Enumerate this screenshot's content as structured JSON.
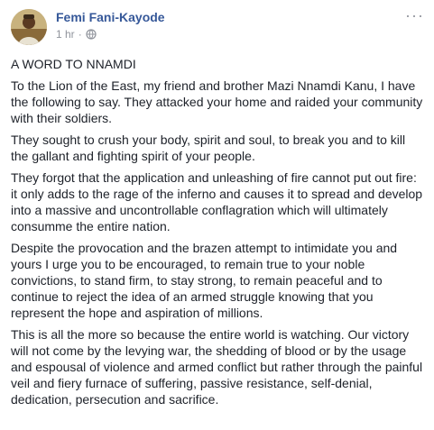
{
  "post": {
    "author": "Femi Fani-Kayode",
    "time": "1 hr",
    "dot": "·",
    "more_label": "···",
    "icons": {
      "globe": "globe-icon",
      "more": "more-options-icon"
    },
    "colors": {
      "author_link": "#365899",
      "meta_text": "#90949c",
      "body_text": "#1d2129"
    },
    "paragraphs": [
      "A WORD TO NNAMDI",
      "To the Lion of the East, my friend and brother Mazi Nnamdi Kanu, I have the following to say. They attacked your home and raided your community with their soldiers.",
      "They sought to crush your body, spirit and soul, to break you and to kill the gallant and fighting spirit of your people.",
      "They forgot that the application and unleashing of fire cannot put out fire: it only adds to the rage of the inferno and causes it to spread and develop into a massive and uncontrollable conflagration which will ultimately consumme the entire nation.",
      "Despite the provocation and the brazen attempt to intimidate you and yours I urge you to be encouraged, to remain true to your noble convictions, to stand firm, to stay strong, to remain peaceful and to continue to reject the idea of an armed struggle knowing that you represent the hope and aspiration of millions.",
      "This is all the more so because the entire world is watching. Our victory will not come by the levying war, the shedding of blood or by the usage and espousal of violence and armed conflict but rather through the painful veil and fiery furnace of suffering, passive resistance, self-denial, dedication, persecution and sacrifice."
    ]
  }
}
